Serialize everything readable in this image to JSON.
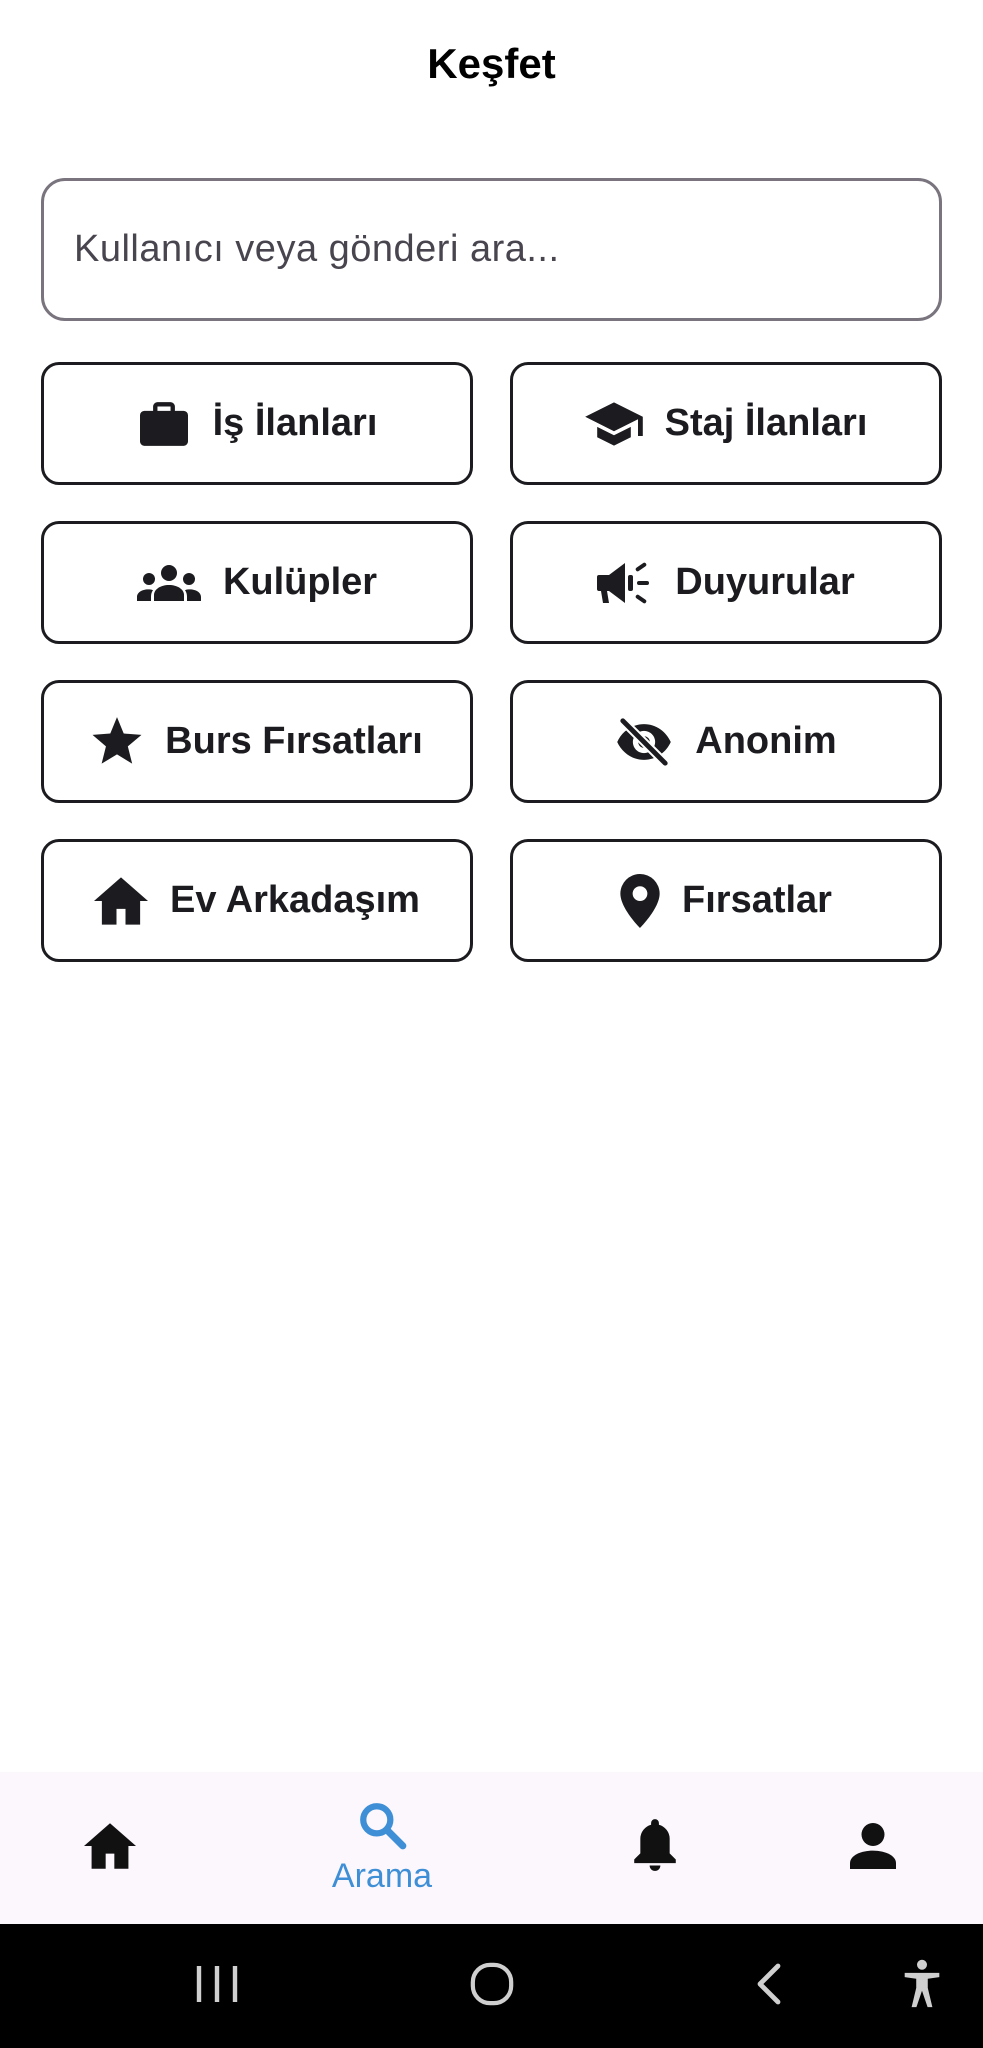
{
  "header": {
    "title": "Keşfet"
  },
  "search": {
    "placeholder": "Kullanıcı veya gönderi ara...",
    "value": ""
  },
  "categories": [
    {
      "label": "İş İlanları",
      "icon": "briefcase-icon"
    },
    {
      "label": "Staj İlanları",
      "icon": "graduation-cap-icon"
    },
    {
      "label": "Kulüpler",
      "icon": "groups-icon"
    },
    {
      "label": "Duyurular",
      "icon": "megaphone-icon"
    },
    {
      "label": "Burs Fırsatları",
      "icon": "star-icon"
    },
    {
      "label": "Anonim",
      "icon": "eye-off-icon"
    },
    {
      "label": "Ev Arkadaşım",
      "icon": "home-icon"
    },
    {
      "label": "Fırsatlar",
      "icon": "location-pin-icon"
    }
  ],
  "bottom_nav": {
    "items": [
      {
        "name": "home",
        "icon": "home-icon",
        "label": ""
      },
      {
        "name": "search",
        "icon": "search-icon",
        "label": "Arama",
        "active": true
      },
      {
        "name": "notifications",
        "icon": "bell-icon",
        "label": ""
      },
      {
        "name": "profile",
        "icon": "person-icon",
        "label": ""
      }
    ]
  },
  "system_nav": {
    "items": [
      "recent-apps-icon",
      "home-circle-icon",
      "back-icon",
      "accessibility-icon"
    ]
  },
  "colors": {
    "accent": "#3e8fd6",
    "text": "#1c1b1f",
    "outline": "#79747e",
    "nav_background": "#fcf7fd",
    "system_bar": "#000000"
  }
}
